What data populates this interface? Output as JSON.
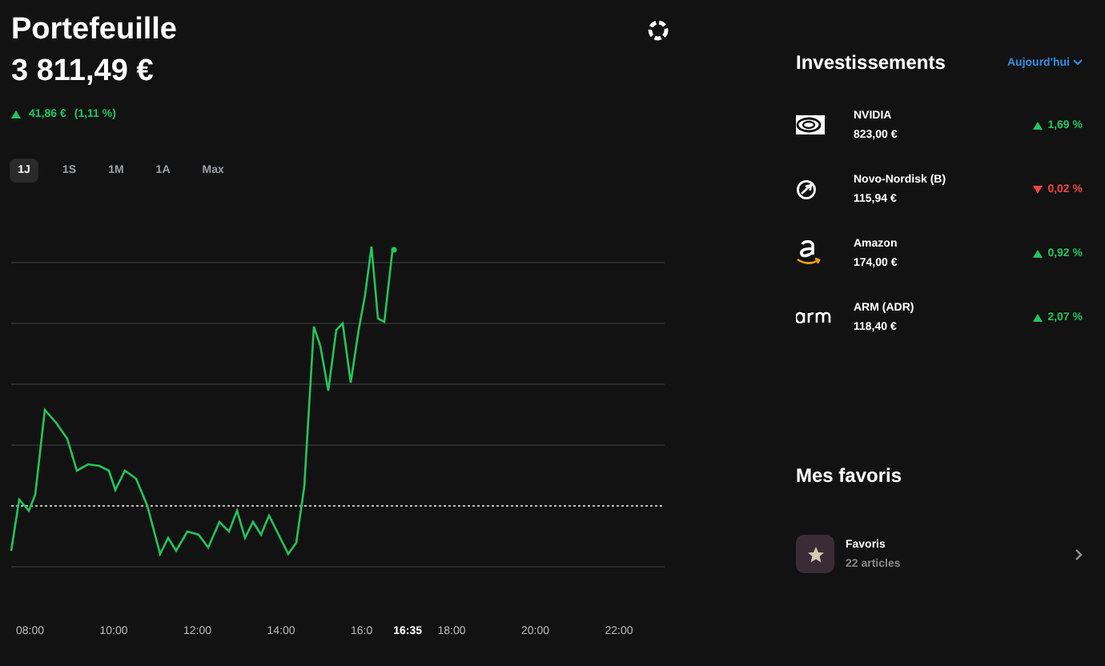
{
  "header": {
    "title": "Portefeuille",
    "value": "3 811,49 €",
    "change": {
      "rising": true,
      "amount": "41,86 €",
      "percent": "(1,11 %)"
    }
  },
  "periods": [
    {
      "label": "1J",
      "selected": true
    },
    {
      "label": "1S",
      "selected": false
    },
    {
      "label": "1M",
      "selected": false
    },
    {
      "label": "1A",
      "selected": false
    },
    {
      "label": "Max",
      "selected": false
    }
  ],
  "chart": {
    "x_labels": [
      "08:00",
      "10:00",
      "12:00",
      "14:00",
      "16:0",
      "18:00",
      "20:00",
      "22:00"
    ],
    "cursor_label": "16:35"
  },
  "investments": {
    "title": "Investissements",
    "filter": "Aujourd'hui",
    "items": [
      {
        "name": "NVIDIA",
        "price": "823,00 €",
        "change": "1,69 %",
        "rising": true,
        "kind": "eye"
      },
      {
        "name": "Novo-Nordisk (B)",
        "price": "115,94 €",
        "change": "0,02 %",
        "rising": false,
        "kind": "ring"
      },
      {
        "name": "Amazon",
        "price": "174,00 €",
        "change": "0,92 %",
        "rising": true,
        "kind": "smile"
      },
      {
        "name": "ARM (ADR)",
        "price": "118,40 €",
        "change": "2,07 %",
        "rising": true,
        "kind": "wordmark"
      }
    ]
  },
  "favorites": {
    "title": "Mes favoris",
    "items": [
      {
        "name": "Favoris",
        "count": "22 articles"
      }
    ]
  }
}
